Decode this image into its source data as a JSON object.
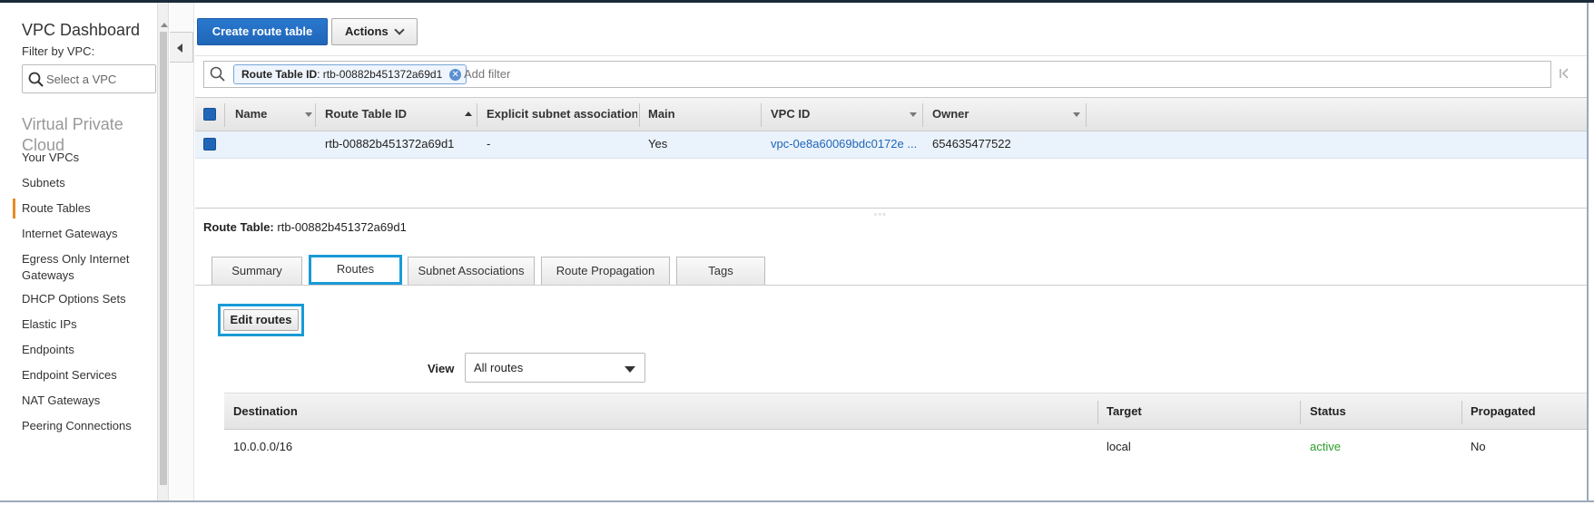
{
  "sidebar": {
    "title": "VPC Dashboard",
    "filter_label": "Filter by VPC:",
    "filter_placeholder": "Select a VPC",
    "section_title": "Virtual Private Cloud",
    "items": [
      {
        "label": "Your VPCs",
        "active": false
      },
      {
        "label": "Subnets",
        "active": false
      },
      {
        "label": "Route Tables",
        "active": true
      },
      {
        "label": "Internet Gateways",
        "active": false
      },
      {
        "label": "Egress Only Internet Gateways",
        "active": false
      },
      {
        "label": "DHCP Options Sets",
        "active": false
      },
      {
        "label": "Elastic IPs",
        "active": false
      },
      {
        "label": "Endpoints",
        "active": false
      },
      {
        "label": "Endpoint Services",
        "active": false
      },
      {
        "label": "NAT Gateways",
        "active": false
      },
      {
        "label": "Peering Connections",
        "active": false
      }
    ]
  },
  "toolbar": {
    "create_label": "Create route table",
    "actions_label": "Actions"
  },
  "filter": {
    "chip_key": "Route Table ID",
    "chip_value": ": rtb-00882b451372a69d1",
    "add_placeholder": "Add filter"
  },
  "table": {
    "columns": [
      "Name",
      "Route Table ID",
      "Explicit subnet association",
      "Main",
      "VPC ID",
      "Owner"
    ],
    "rows": [
      {
        "name": "",
        "route_table_id": "rtb-00882b451372a69d1",
        "explicit": "-",
        "main": "Yes",
        "vpc_id": "vpc-0e8a60069bdc0172e ...",
        "owner": "654635477522"
      }
    ]
  },
  "detail": {
    "label": "Route Table:",
    "value": "rtb-00882b451372a69d1",
    "tabs": [
      "Summary",
      "Routes",
      "Subnet Associations",
      "Route Propagation",
      "Tags"
    ],
    "active_tab": "Routes",
    "edit_label": "Edit routes",
    "view_label": "View",
    "view_value": "All routes",
    "routes_columns": [
      "Destination",
      "Target",
      "Status",
      "Propagated"
    ],
    "routes": [
      {
        "destination": "10.0.0.0/16",
        "target": "local",
        "status": "active",
        "propagated": "No"
      }
    ]
  },
  "colors": {
    "primary": "#1f66b8",
    "selected_tab_border": "#1a9bd7",
    "active_nav": "#e48b27",
    "status_active": "#2a9d2a"
  }
}
